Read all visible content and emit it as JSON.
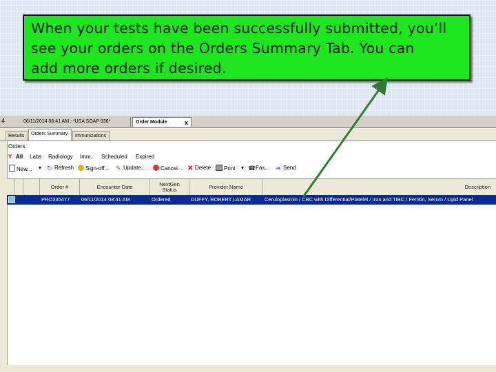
{
  "callout": {
    "line1": "When your tests have been successfully submitted, you’ll",
    "line2": "see your orders on the Orders Summary Tab.  You can",
    "line3": "add more orders if desired."
  },
  "doc_tabs": {
    "number": "4",
    "tab1": "06/11/2014 08:41 AM : *USA SOAP 836*",
    "tab2": "Order Module",
    "close": "x"
  },
  "sub_tabs": [
    "Results",
    "Orders Summary",
    "Immunizations"
  ],
  "orders_label": "Orders",
  "filters": [
    "All",
    "Labs",
    "Radiology",
    "Imm.",
    "Scheduled",
    "Expired"
  ],
  "toolbar": {
    "new": "New...",
    "refresh": "Refresh",
    "sign_off": "Sign-off...",
    "update": "Update...",
    "cancel": "Cancel...",
    "delete": "Delete",
    "print": "Print",
    "fax": "Fax...",
    "send": "Send"
  },
  "table": {
    "headers": {
      "order": "Order #",
      "encounter_date": "Encounter Date",
      "nextgen_status": "NextGen Status",
      "provider": "Provider Name",
      "description": "Description"
    },
    "row": {
      "order": "PRO335477",
      "encounter_date": "06/11/2014 08:41 AM",
      "status": "Ordered",
      "provider": "DUFFY, ROBERT LAMAR",
      "description": "Ceruloplasmin / CBC with Differential/Platelet / Iron and TIBC / Ferritin, Serum / Lipid Panel"
    }
  },
  "colors": {
    "callout_bg": "#1ee61e",
    "selected_row": "#0a2b8f",
    "arrow": "#2e7d32"
  }
}
